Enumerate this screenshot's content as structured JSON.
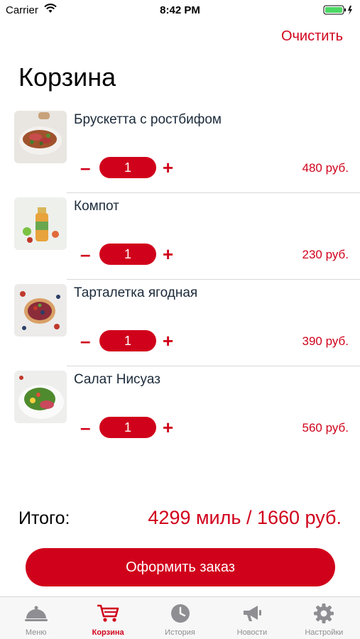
{
  "status_bar": {
    "carrier": "Carrier",
    "time": "8:42 PM"
  },
  "header": {
    "clear_label": "Очистить",
    "title": "Корзина"
  },
  "cart": {
    "items": [
      {
        "name": "Брускетта с ростбифом",
        "minus": "–",
        "quantity": "1",
        "plus": "+",
        "price": "480 руб."
      },
      {
        "name": "Компот",
        "minus": "–",
        "quantity": "1",
        "plus": "+",
        "price": "230 руб."
      },
      {
        "name": "Тарталетка ягодная",
        "minus": "–",
        "quantity": "1",
        "plus": "+",
        "price": "390 руб."
      },
      {
        "name": "Салат Нисуаз",
        "minus": "–",
        "quantity": "1",
        "plus": "+",
        "price": "560 руб."
      }
    ]
  },
  "summary": {
    "total_label": "Итого:",
    "total_value": "4299 миль / 1660 руб."
  },
  "order_button_label": "Оформить заказ",
  "tab_bar": {
    "tabs": [
      {
        "label": "Меню",
        "icon": "cloche-icon"
      },
      {
        "label": "Корзина",
        "icon": "cart-icon"
      },
      {
        "label": "История",
        "icon": "clock-icon"
      },
      {
        "label": "Новости",
        "icon": "megaphone-icon"
      },
      {
        "label": "Настройки",
        "icon": "gear-icon"
      }
    ],
    "active_index": 1
  },
  "colors": {
    "accent": "#d0021b",
    "inactive_tab": "#8e8e93",
    "item_title": "#1b2a3a"
  }
}
